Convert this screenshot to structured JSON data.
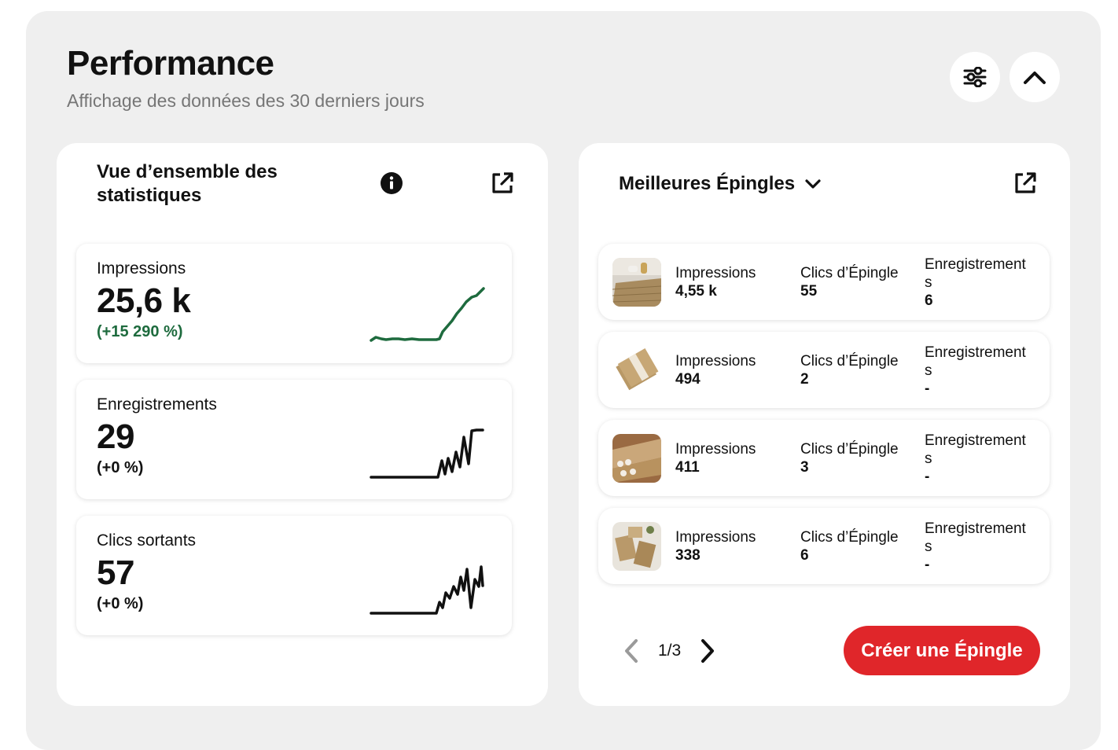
{
  "header": {
    "title": "Performance",
    "subtitle": "Affichage des données des 30 derniers jours"
  },
  "overview": {
    "title": "Vue d’ensemble des statistiques",
    "stats": [
      {
        "label": "Impressions",
        "value": "25,6 k",
        "change": "(+15 290 %)"
      },
      {
        "label": "Enregistrements",
        "value": "29",
        "change": "(+0 %)"
      },
      {
        "label": "Clics sortants",
        "value": "57",
        "change": "(+0 %)"
      }
    ]
  },
  "top_pins": {
    "title": "Meilleures Épingles",
    "columns": {
      "impressions": "Impressions",
      "clicks": "Clics d’Épingle",
      "saves_line1": "Enregistrement",
      "saves_line2": "s"
    },
    "rows": [
      {
        "impressions": "4,55 k",
        "clicks": "55",
        "saves": "6"
      },
      {
        "impressions": "494",
        "clicks": "2",
        "saves": "-"
      },
      {
        "impressions": "411",
        "clicks": "3",
        "saves": "-"
      },
      {
        "impressions": "338",
        "clicks": "6",
        "saves": "-"
      }
    ],
    "page": "1/3",
    "create_label": "Créer une Épingle"
  },
  "colors": {
    "accent_red": "#e0262a",
    "positive_green": "#1e6b3e",
    "panel_bg": "#efefef"
  },
  "icons": [
    "filter-sliders-icon",
    "chevron-up-icon",
    "info-icon",
    "external-link-icon",
    "chevron-down-icon",
    "chevron-left-icon",
    "chevron-right-icon"
  ]
}
